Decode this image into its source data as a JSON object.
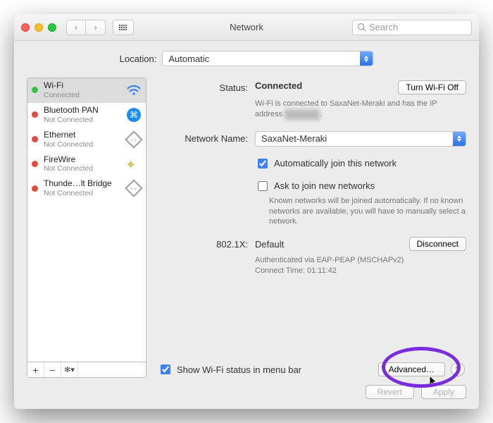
{
  "window": {
    "title": "Network"
  },
  "search": {
    "placeholder": "Search"
  },
  "location": {
    "label": "Location:",
    "value": "Automatic"
  },
  "services": [
    {
      "name": "Wi-Fi",
      "status": "Connected",
      "dot": "green",
      "icon": "wifi",
      "selected": true
    },
    {
      "name": "Bluetooth PAN",
      "status": "Not Connected",
      "dot": "red",
      "icon": "bluetooth",
      "selected": false
    },
    {
      "name": "Ethernet",
      "status": "Not Connected",
      "dot": "red",
      "icon": "ethernet",
      "selected": false
    },
    {
      "name": "FireWire",
      "status": "Not Connected",
      "dot": "red",
      "icon": "firewire",
      "selected": false
    },
    {
      "name": "Thunde…lt Bridge",
      "status": "Not Connected",
      "dot": "red",
      "icon": "thunderbolt",
      "selected": false
    }
  ],
  "footer_buttons": {
    "add": "+",
    "remove": "−",
    "gear": "✻▾"
  },
  "detail": {
    "status_label": "Status:",
    "status_value": "Connected",
    "turn_off": "Turn Wi-Fi Off",
    "status_note_pre": "Wi-Fi is connected to SaxaNet-Meraki and has the IP address ",
    "status_note_post": ".",
    "network_label": "Network Name:",
    "network_value": "SaxaNet-Meraki",
    "auto_join": "Automatically join this network",
    "ask_join": "Ask to join new networks",
    "ask_note": "Known networks will be joined automatically. If no known networks are available, you will have to manually select a network.",
    "dot1x_label": "802.1X:",
    "dot1x_value": "Default",
    "disconnect": "Disconnect",
    "dot1x_auth": "Authenticated via EAP-PEAP (MSCHAPv2)",
    "dot1x_time": "Connect Time: 01:11:42",
    "show_menu": "Show Wi-Fi status in menu bar",
    "advanced": "Advanced…",
    "help": "?"
  },
  "buttons": {
    "revert": "Revert",
    "apply": "Apply"
  }
}
